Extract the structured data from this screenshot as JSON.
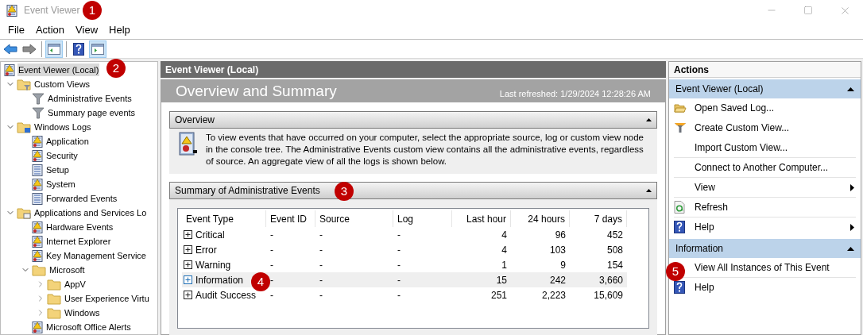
{
  "window": {
    "title": "Event Viewer"
  },
  "menu": [
    "File",
    "Action",
    "View",
    "Help"
  ],
  "toolbar": [
    {
      "kind": "back",
      "pressed": false
    },
    {
      "kind": "forward",
      "pressed": false
    },
    {
      "kind": "separator"
    },
    {
      "kind": "console-tree",
      "pressed": true
    },
    {
      "kind": "separator"
    },
    {
      "kind": "help",
      "pressed": false
    },
    {
      "kind": "action-pane",
      "pressed": true
    }
  ],
  "tree": [
    {
      "label": "Event Viewer (Local)",
      "kind": "log",
      "selected": true,
      "children": [
        {
          "label": "Custom Views",
          "kind": "folder-filter",
          "selected": false,
          "expanded": true,
          "children": [
            {
              "label": "Administrative Events",
              "kind": "filter",
              "selected": false
            },
            {
              "label": "Summary page events",
              "kind": "filter",
              "selected": false
            }
          ]
        },
        {
          "label": "Windows Logs",
          "kind": "folder-logs",
          "selected": false,
          "expanded": true,
          "children": [
            {
              "label": "Application",
              "kind": "log",
              "selected": false
            },
            {
              "label": "Security",
              "kind": "log",
              "selected": false
            },
            {
              "label": "Setup",
              "kind": "log-plain",
              "selected": false
            },
            {
              "label": "System",
              "kind": "log",
              "selected": false
            },
            {
              "label": "Forwarded Events",
              "kind": "log-plain",
              "selected": false
            }
          ]
        },
        {
          "label": "Applications and Services Lo",
          "kind": "folder-apps",
          "selected": false,
          "expanded": true,
          "children": [
            {
              "label": "Hardware Events",
              "kind": "log",
              "selected": false
            },
            {
              "label": "Internet Explorer",
              "kind": "log",
              "selected": false
            },
            {
              "label": "Key Management Service",
              "kind": "log",
              "selected": false
            },
            {
              "label": "Microsoft",
              "kind": "folder",
              "selected": false,
              "expanded": true,
              "children": [
                {
                  "label": "AppV",
                  "kind": "folder",
                  "selected": false,
                  "expanded": false
                },
                {
                  "label": "User Experience Virtu",
                  "kind": "folder",
                  "selected": false,
                  "expanded": false
                },
                {
                  "label": "Windows",
                  "kind": "folder",
                  "selected": false,
                  "expanded": false
                }
              ]
            },
            {
              "label": "Microsoft Office Alerts",
              "kind": "log",
              "selected": false
            }
          ]
        }
      ]
    }
  ],
  "center": {
    "header": "Event Viewer (Local)",
    "title": "Overview and Summary",
    "last_refreshed": "Last refreshed: 1/29/2024 12:28:26 AM",
    "overview": {
      "title": "Overview",
      "expanded": true,
      "text": "To view events that have occurred on your computer, select the appropriate source, log or custom view node in the console tree. The Administrative Events custom view contains all the administrative events, regardless of source. An aggregate view of all the logs is shown below."
    },
    "summary": {
      "title": "Summary of Administrative Events",
      "expanded": true,
      "columns": [
        "Event Type",
        "Event ID",
        "Source",
        "Log",
        "Last hour",
        "24 hours",
        "7 days"
      ],
      "rows": [
        {
          "cells": [
            "Critical",
            "-",
            "-",
            "-",
            "4",
            "96",
            "452"
          ],
          "selected": false
        },
        {
          "cells": [
            "Error",
            "-",
            "-",
            "-",
            "4",
            "103",
            "508"
          ],
          "selected": false
        },
        {
          "cells": [
            "Warning",
            "-",
            "-",
            "-",
            "1",
            "9",
            "154"
          ],
          "selected": false
        },
        {
          "cells": [
            "Information",
            "-",
            "-",
            "-",
            "15",
            "242",
            "3,660"
          ],
          "selected": true
        },
        {
          "cells": [
            "Audit Success",
            "-",
            "-",
            "-",
            "251",
            "2,223",
            "15,609"
          ],
          "selected": false
        }
      ]
    }
  },
  "actions": {
    "title": "Actions",
    "sections": [
      {
        "title": "Event Viewer (Local)",
        "expanded": true,
        "items": [
          {
            "label": "Open Saved Log...",
            "kind": "open-folder",
            "submenu": false,
            "separator_after": false
          },
          {
            "label": "Create Custom View...",
            "kind": "filter",
            "submenu": false,
            "separator_after": false
          },
          {
            "label": "Import Custom View...",
            "kind": "plain",
            "submenu": false,
            "separator_after": true
          },
          {
            "label": "Connect to Another Computer...",
            "kind": "plain",
            "submenu": false,
            "separator_after": true
          },
          {
            "label": "View",
            "kind": "plain",
            "submenu": true,
            "separator_after": true
          },
          {
            "label": "Refresh",
            "kind": "refresh",
            "submenu": false,
            "separator_after": true
          },
          {
            "label": "Help",
            "kind": "help",
            "submenu": true,
            "separator_after": false
          }
        ]
      },
      {
        "title": "Information",
        "expanded": true,
        "items": [
          {
            "label": "View All Instances of This Event",
            "kind": "plain",
            "submenu": false,
            "separator_after": true
          },
          {
            "label": "Help",
            "kind": "help",
            "submenu": false,
            "separator_after": false
          }
        ]
      }
    ]
  },
  "callouts": [
    "1",
    "2",
    "3",
    "4",
    "5"
  ]
}
